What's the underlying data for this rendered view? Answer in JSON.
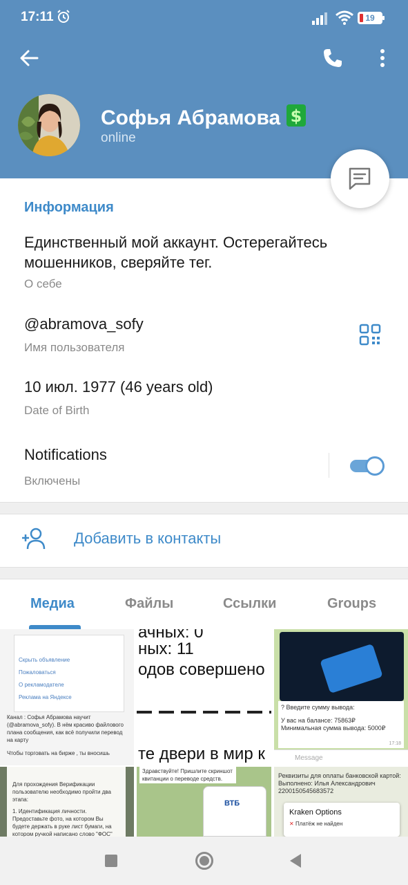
{
  "status_bar": {
    "time": "17:11",
    "battery": "19"
  },
  "header": {
    "name": "Софья Абрамова",
    "status": "online"
  },
  "info": {
    "section_title": "Информация",
    "bio": "Единственный мой аккаунт. Остерегайтесь мошенников, сверяйте тег.",
    "bio_label": "О себе",
    "username": "@abramova_sofy",
    "username_label": "Имя пользователя",
    "dob": "10 июл. 1977 (46 years old)",
    "dob_label": "Date of Birth",
    "notifications": "Notifications",
    "notifications_state": "Включены",
    "notifications_on": true
  },
  "add_contact": {
    "label": "Добавить в контакты"
  },
  "tabs": [
    {
      "label": "Медиа",
      "active": true
    },
    {
      "label": "Файлы",
      "active": false
    },
    {
      "label": "Ссылки",
      "active": false
    },
    {
      "label": "Groups",
      "active": false
    }
  ],
  "media": {
    "t1": {
      "menu": [
        "Скрыть объявление",
        "Пожаловаться",
        "О рекламодателе",
        "Реклама на Яндексе"
      ],
      "caption": "Канал : Софья Абрамова научит (@abramova_sofy). В нём красиво файлового плана сообщения, как всё получили перевод на карту",
      "caption2": "Чтобы торговать на бирже , ты вносишь"
    },
    "t2": {
      "lines": [
        "ачных: 0",
        "ных: 11",
        "одов совершено",
        "те двери в мир к"
      ]
    },
    "t3": {
      "prompt": "? Введите сумму вывода:",
      "balance": "У вас на балансе: 75863₽",
      "minimum": "Минимальная сумма вывода: 5000₽",
      "time": "17:18",
      "input_placeholder": "Message"
    },
    "t4": {
      "text": "Для прохождения Верификации пользователю необходимо пройти два этапа:",
      "text2": "1. Идентификация личности. Предоставьте фото, на котором Вы будете держать в руке лист бумаги, на котором ручкой написано слово \"ФОС\""
    },
    "t5": {
      "text": "Здравствуйте! Пришлите скриншот квитанции о переводе средств.",
      "bank": "ВТБ"
    },
    "t6": {
      "text": "Реквизиты для оплаты банковской картой:",
      "name": "Выполнено: Илья Александрович",
      "card": "2200150545683572",
      "dialog_title": "Kraken Options",
      "dialog_text": "Платёж не найден"
    }
  },
  "icons": {
    "back": "arrow-left-icon",
    "call": "phone-icon",
    "menu": "more-vertical-icon",
    "message": "message-icon",
    "qr": "qr-code-icon",
    "add_contact": "add-user-icon"
  },
  "colors": {
    "header": "#5b8fbf",
    "accent": "#3e8ac9",
    "secondary_text": "#8a8a8a"
  }
}
